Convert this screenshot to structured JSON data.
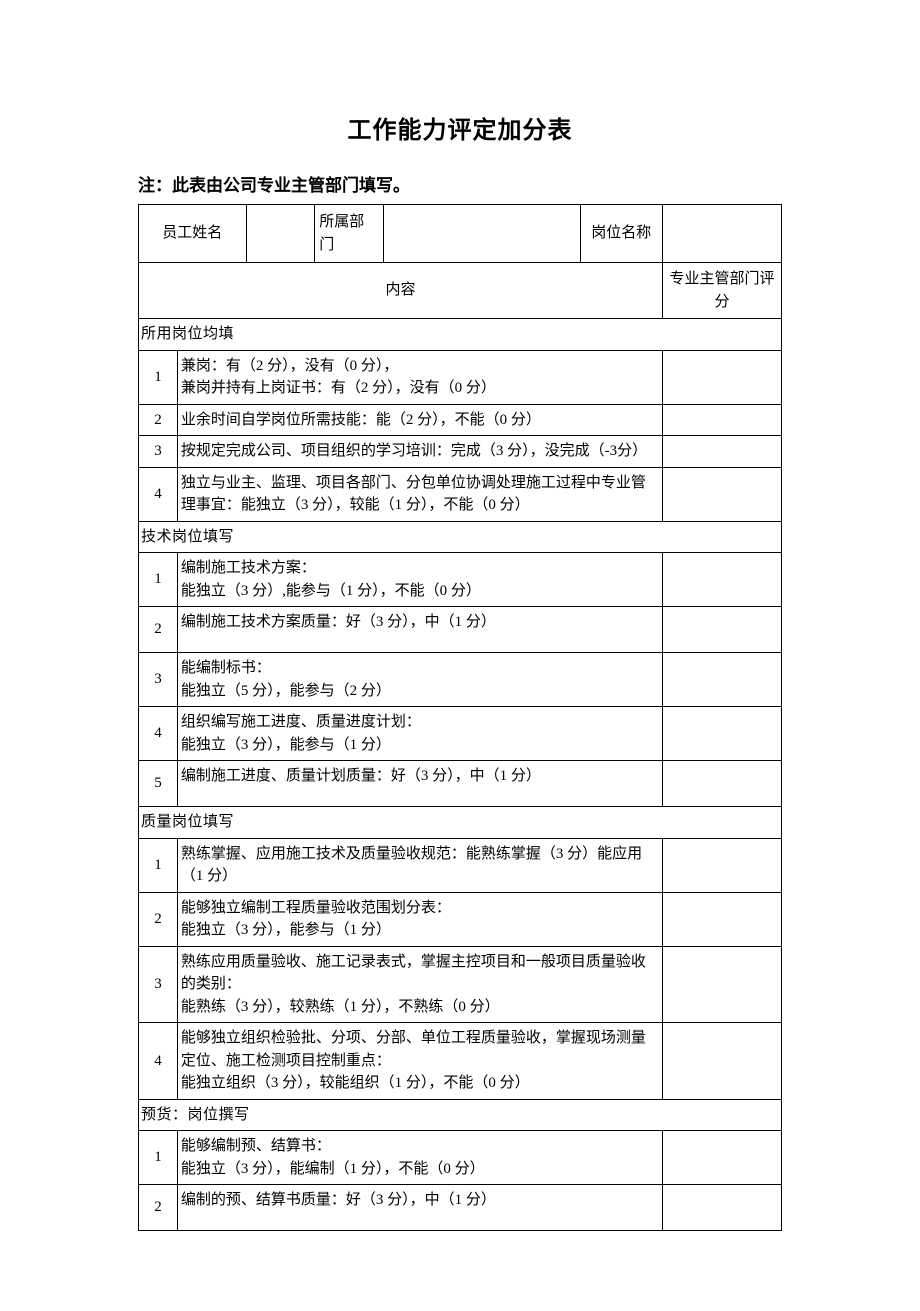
{
  "title": "工作能力评定加分表",
  "note": "注：此表由公司专业主管部门填写。",
  "header": {
    "employee_label": "员工姓名",
    "dept_label": "所属部门",
    "position_label": "岗位名称",
    "content_label": "内容",
    "score_label": "专业主管部门评分"
  },
  "sections": [
    {
      "title": "所用岗位均填",
      "rows": [
        {
          "no": "1",
          "text": "兼岗：有（2 分），没有（0 分），\n兼岗并持有上岗证书：有（2 分），没有（0 分）"
        },
        {
          "no": "2",
          "text": "业余时间自学岗位所需技能：能（2 分），不能（0 分）"
        },
        {
          "no": "3",
          "text": "按规定完成公司、项目组织的学习培训：完成（3 分），没完成（-3分）"
        },
        {
          "no": "4",
          "text": "独立与业主、监理、项目各部门、分包单位协调处理施工过程中专业管理事宜：能独立（3 分），较能（1 分），不能（0 分）"
        }
      ]
    },
    {
      "title": "技术岗位填写",
      "rows": [
        {
          "no": "1",
          "text": "编制施工技术方案：\n能独立（3 分）,能参与（1 分），不能（0 分）"
        },
        {
          "no": "2",
          "text": "编制施工技术方案质量：好（3 分），中（1 分）",
          "tall": true
        },
        {
          "no": "3",
          "text": "能编制标书：\n能独立（5 分），能参与（2 分）"
        },
        {
          "no": "4",
          "text": "组织编写施工进度、质量进度计划：\n能独立（3 分），能参与（1 分）"
        },
        {
          "no": "5",
          "text": "编制施工进度、质量计划质量：好（3 分），中（1 分）",
          "tall": true
        }
      ]
    },
    {
      "title": "质量岗位填写",
      "rows": [
        {
          "no": "1",
          "text": "熟练掌握、应用施工技术及质量验收规范：能熟练掌握（3 分）能应用（1 分）"
        },
        {
          "no": "2",
          "text": "能够独立编制工程质量验收范围划分表：\n能独立（3 分），能参与（1 分）"
        },
        {
          "no": "3",
          "text": "熟练应用质量验收、施工记录表式，掌握主控项目和一般项目质量验收的类别：\n能熟练（3 分），较熟练（1 分），不熟练（0 分）"
        },
        {
          "no": "4",
          "text": "能够独立组织检验批、分项、分部、单位工程质量验收，掌握现场测量定位、施工检测项目控制重点：\n能独立组织（3 分），较能组织（1 分），不能（0 分）"
        }
      ]
    },
    {
      "title": "预货：岗位撰写",
      "rows": [
        {
          "no": "1",
          "text": "能够编制预、结算书：\n能独立（3 分），能编制（1 分），不能（0 分）"
        },
        {
          "no": "2",
          "text": "编制的预、结算书质量：好（3 分），中（1 分）",
          "tall": true
        }
      ]
    }
  ]
}
